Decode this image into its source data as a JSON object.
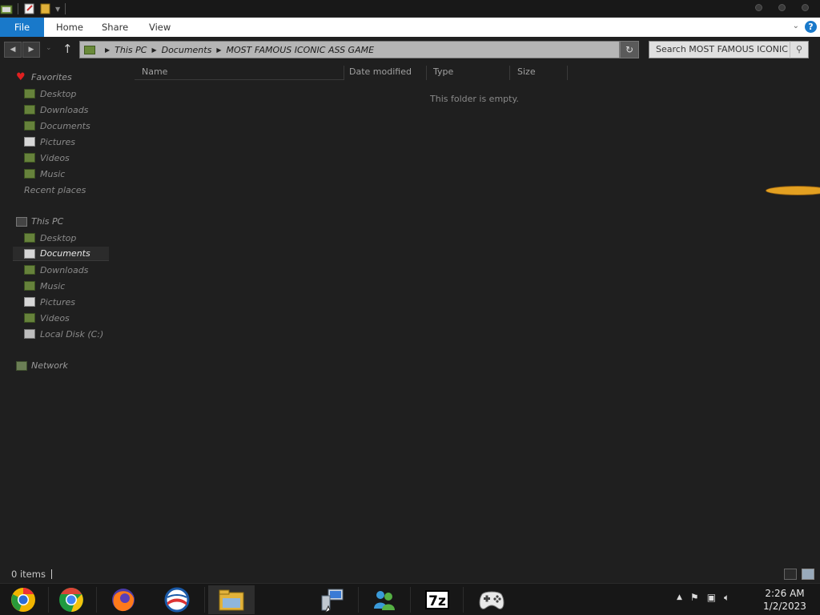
{
  "ribbon": {
    "tabs": [
      "File",
      "Home",
      "Share",
      "View"
    ],
    "help": "?"
  },
  "address": {
    "crumbs": [
      "This PC",
      "Documents",
      "MOST FAMOUS ICONIC ASS GAME"
    ]
  },
  "search": {
    "placeholder": "Search MOST FAMOUS ICONIC ..."
  },
  "navpane": {
    "favorites_label": "Favorites",
    "favorites": [
      "Desktop",
      "Downloads",
      "Documents",
      "Pictures",
      "Videos",
      "Music",
      "Recent places"
    ],
    "thispc_label": "This PC",
    "thispc": [
      "Desktop",
      "Documents",
      "Downloads",
      "Music",
      "Pictures",
      "Videos",
      "Local Disk (C:)"
    ],
    "network_label": "Network",
    "selected": "Documents"
  },
  "columns": {
    "name": "Name",
    "date": "Date modified",
    "type": "Type",
    "size": "Size"
  },
  "content": {
    "empty_message": "This folder is empty."
  },
  "status": {
    "item_count": "0 items"
  },
  "taskbar": {
    "apps": [
      "chrome-canary",
      "chrome",
      "firefox",
      "windows-live",
      "file-explorer",
      "network-connections",
      "messenger",
      "7-zip",
      "game-controller"
    ],
    "seven_zip_label": "7z",
    "time": "2:26 AM",
    "date": "1/2/2023"
  },
  "colors": {
    "accent": "#1979ca",
    "background": "#1f1f1f",
    "folder": "#66823b"
  }
}
